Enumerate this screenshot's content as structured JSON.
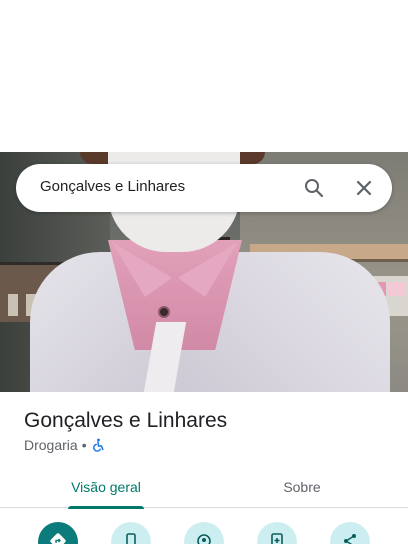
{
  "search": {
    "query": "Gonçalves e Linhares",
    "search_icon": "search-icon",
    "close_icon": "close-icon"
  },
  "place": {
    "name": "Gonçalves e Linhares",
    "category": "Drogaria",
    "separator": "•",
    "accessibility_icon": "wheelchair-icon"
  },
  "tabs": [
    {
      "label": "Visão geral",
      "active": true
    },
    {
      "label": "Sobre",
      "active": false
    }
  ],
  "actions": [
    {
      "icon": "directions-icon",
      "style": "primary"
    },
    {
      "icon": "phone-icon",
      "style": "secondary"
    },
    {
      "icon": "location-icon",
      "style": "secondary"
    },
    {
      "icon": "save-icon",
      "style": "secondary"
    },
    {
      "icon": "share-icon",
      "style": "secondary"
    }
  ],
  "colors": {
    "accent": "#00796b",
    "primary_action": "#0b7b7b",
    "secondary_action": "#cdeef0",
    "accessibility": "#1a73e8"
  }
}
